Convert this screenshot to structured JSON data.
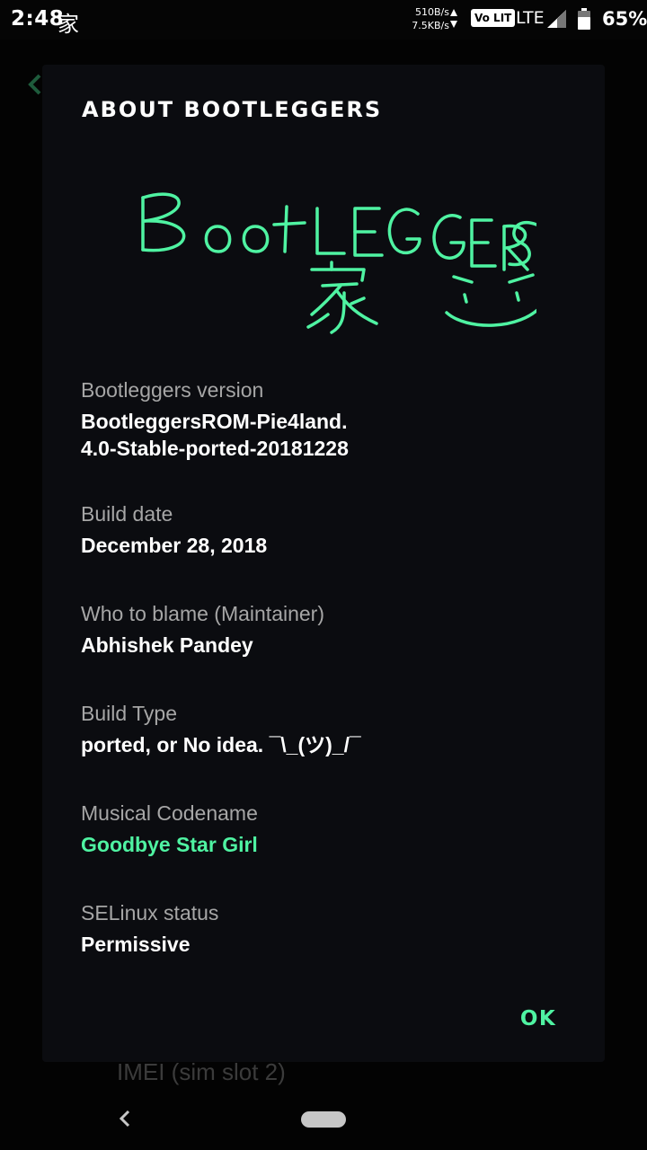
{
  "status_bar": {
    "time": "2:48",
    "glyph": "家",
    "upload_speed": "510B/s",
    "download_speed": "7.5KB/s",
    "volte": "Vo LIT",
    "network": "LTE",
    "battery": "65%"
  },
  "background": {
    "imei_label": "IMEI (sim slot 2)"
  },
  "dialog": {
    "title": "ABOUT BOOTLEGGERS",
    "logo_text": "BootLEGGERS 家",
    "items": [
      {
        "label": "Bootleggers version",
        "value": "BootleggersROM-Pie4land.\n4.0-Stable-ported-20181228"
      },
      {
        "label": "Build date",
        "value": "December 28, 2018"
      },
      {
        "label": "Who to blame (Maintainer)",
        "value": "Abhishek Pandey"
      },
      {
        "label": "Build Type",
        "value": "ported, or No idea. ¯\\_(ツ)_/¯"
      },
      {
        "label": "Musical Codename",
        "value": "Goodbye Star Girl"
      },
      {
        "label": "SELinux status",
        "value": "Permissive"
      }
    ],
    "ok_label": "OK"
  },
  "colors": {
    "accent": "#4ff3a2",
    "dialog_bg": "#0b0c10",
    "label_text": "#a6a6a6",
    "value_text": "#ffffff"
  },
  "icons": {
    "back": "arrow-left-icon",
    "signal": "signal-icon",
    "battery": "battery-icon",
    "nav_back": "nav-back-icon",
    "nav_home": "nav-home-pill"
  }
}
